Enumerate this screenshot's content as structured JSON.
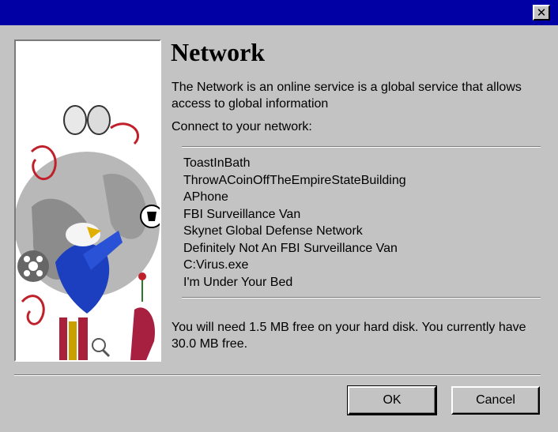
{
  "window": {
    "close_label": "✕"
  },
  "heading": "Network",
  "description": "The Network is an online service is a global service that allows access to global information",
  "connect_label": "Connect to your network:",
  "networks": [
    "ToastInBath",
    "ThrowACoinOffTheEmpireStateBuilding",
    "APhone",
    "FBI Surveillance Van",
    "Skynet Global Defense Network",
    "Definitely Not An FBI Surveillance Van",
    "C:Virus.exe",
    "I'm Under Your Bed"
  ],
  "disk_info": "You will need 1.5 MB free on your hard disk. You currently have 30.0 MB free.",
  "buttons": {
    "ok": "OK",
    "cancel": "Cancel"
  },
  "colors": {
    "titlebar": "#0000a4",
    "face": "#c3c3c3"
  }
}
